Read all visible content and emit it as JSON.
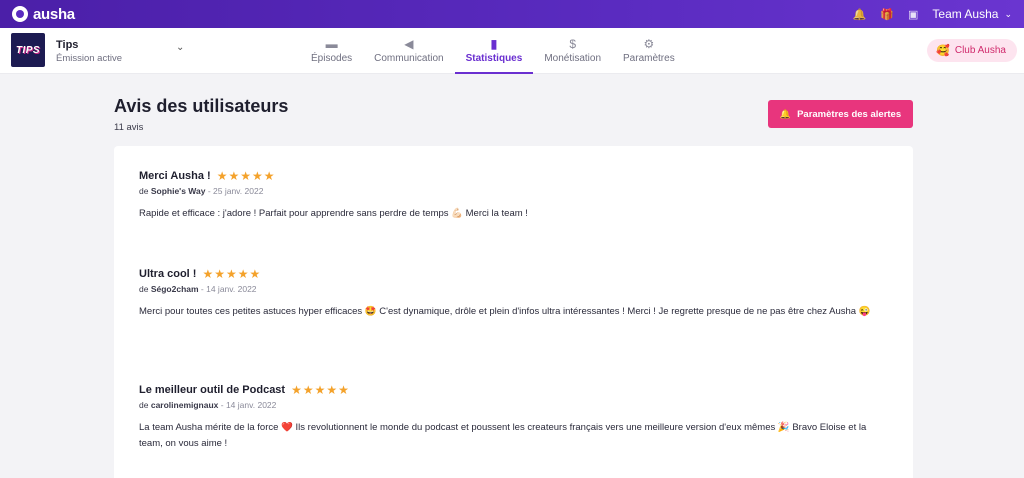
{
  "app": {
    "brand": "ausha"
  },
  "topbar": {
    "team_label": "Team Ausha",
    "bell_icon": "bell-icon",
    "gift_icon": "gift-icon",
    "calendar_icon": "calendar-icon"
  },
  "show": {
    "cover_text": "TIPS",
    "name": "Tips",
    "status": "Émission active"
  },
  "tabs": [
    {
      "label": "Épisodes",
      "icon": "episodes-icon",
      "glyph": "▬"
    },
    {
      "label": "Communication",
      "icon": "megaphone-icon",
      "glyph": "📢"
    },
    {
      "label": "Statistiques",
      "icon": "stats-icon",
      "glyph": "▮"
    },
    {
      "label": "Monétisation",
      "icon": "dollar-icon",
      "glyph": "$"
    },
    {
      "label": "Paramètres",
      "icon": "gear-icon",
      "glyph": "⚙"
    }
  ],
  "club": {
    "label": "Club Ausha",
    "icon": "heart-icon"
  },
  "page": {
    "title": "Avis des utilisateurs",
    "count": "11 avis",
    "alert_button": "Paramètres des alertes"
  },
  "reviews": [
    {
      "title": "Merci Ausha !",
      "rating": 5,
      "by": "de",
      "author": "Sophie's Way",
      "date": " - 25 janv. 2022",
      "body": "Rapide et efficace : j'adore ! Parfait pour apprendre sans perdre de temps 💪🏻 Merci la team !"
    },
    {
      "title": "Ultra cool !",
      "rating": 5,
      "by": "de",
      "author": "Ségo2cham",
      "date": " - 14 janv. 2022",
      "body": "Merci pour toutes ces petites astuces hyper efficaces 🤩 C'est dynamique, drôle et plein d'infos ultra intéressantes ! Merci ! Je regrette presque de ne pas être chez Ausha 😜"
    },
    {
      "title": "Le meilleur outil de Podcast",
      "rating": 5,
      "by": "de",
      "author": "carolinemignaux",
      "date": " - 14 janv. 2022",
      "body": "La team Ausha mérite de la force ❤️ Ils revolutionnent le monde du podcast et poussent les createurs français vers une meilleure version d'eux mêmes 🎉 Bravo Eloise et la team, on vous aime !"
    }
  ],
  "colors": {
    "primary": "#6a2fd0",
    "accent": "#e8357d",
    "star": "#f4a22b"
  }
}
